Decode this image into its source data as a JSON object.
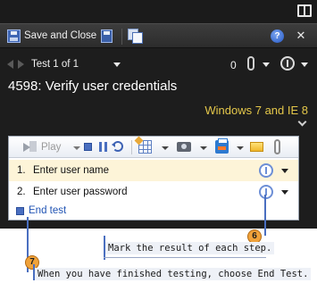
{
  "toolbar": {
    "save_close_label": "Save and Close",
    "save_icon": "save-icon",
    "copy_icon": "copy-icon",
    "help_icon": "help-icon",
    "close_glyph": "✕"
  },
  "navigation": {
    "test_counter": "Test 1 of 1",
    "attachment_count": "0"
  },
  "test": {
    "title": "4598: Verify user credentials",
    "configuration": "Windows 7 and IE 8"
  },
  "steps_toolbar": {
    "play_label": "Play"
  },
  "steps": [
    {
      "number": "1.",
      "text": "Enter user name"
    },
    {
      "number": "2.",
      "text": "Enter user password"
    }
  ],
  "end_test_label": "End test",
  "callouts": [
    {
      "number": "6",
      "text": "Mark the result of each step."
    },
    {
      "number": "7",
      "text": "When you have finished testing, choose End Test."
    }
  ],
  "colors": {
    "runner_background": "#1d1d1d",
    "configuration_text": "#e4c74a",
    "link_blue": "#2154b4",
    "callout_badge": "#f0a23a",
    "active_row": "#fdf4d8"
  }
}
